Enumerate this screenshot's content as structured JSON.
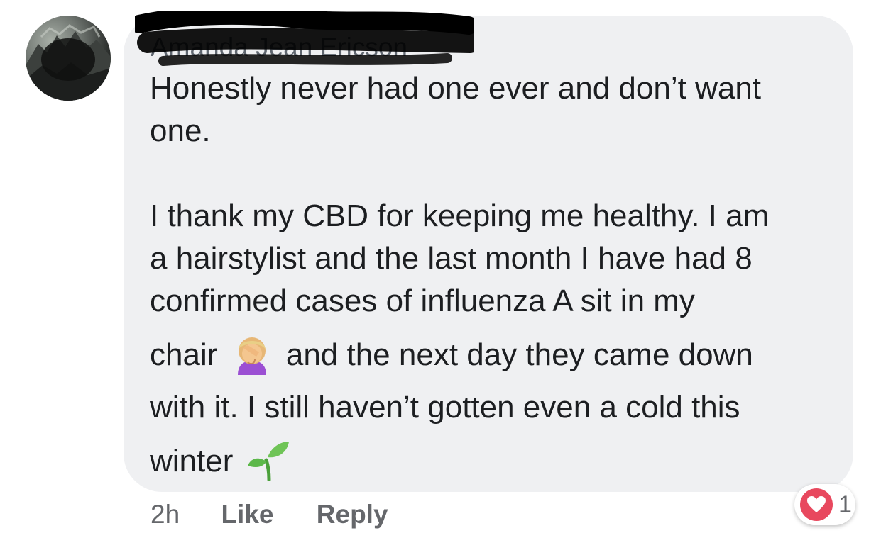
{
  "comment": {
    "author": "Amanda Jean Ericson",
    "paragraphs": [
      {
        "lines": [
          "Honestly never had one ever and don’t want",
          "one."
        ]
      },
      {
        "lines": [
          "I thank my CBD for keeping me healthy. I am",
          "a hairstylist and the last month I have had 8",
          "confirmed cases of influenza A sit in my"
        ]
      }
    ],
    "line_chair_before": "chair",
    "line_chair_after": "and the next day they came down",
    "line_with_it": "with it. I still haven’t gotten even a cold this",
    "line_winter": "winter",
    "emojis": {
      "facepalm": "person-facepalming-emoji",
      "seedling": "seedling-emoji"
    }
  },
  "actions": {
    "time": "2h",
    "like_label": "Like",
    "reply_label": "Reply"
  },
  "reaction": {
    "icon": "heart-icon",
    "color": "#e8485e",
    "count": "1"
  }
}
